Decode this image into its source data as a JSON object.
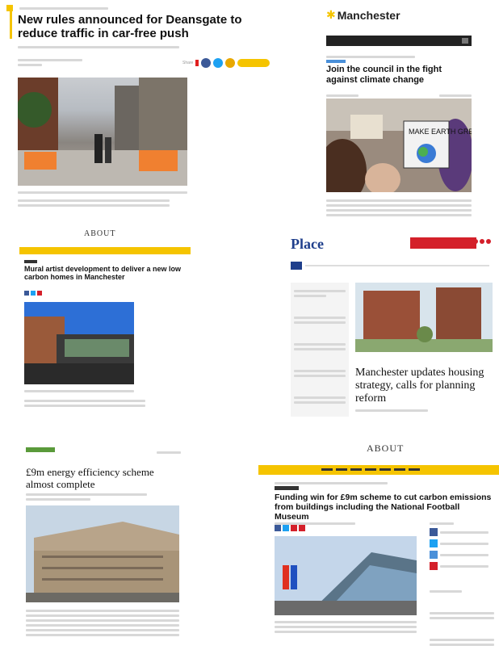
{
  "articles": [
    {
      "title": "New rules announced for Deansgate to reduce traffic in car-free push",
      "social_colors": [
        "#e02020",
        "#3b5998",
        "#1da1f2",
        "#e8a800"
      ]
    },
    {
      "site": "Manchester",
      "title": "Join the council in the fight against climate change",
      "placard": "MAKE EARTH GREEN AGAIN"
    },
    {
      "site": "ABOUT",
      "title": "Mural artist development to deliver a new low carbon homes in Manchester"
    },
    {
      "site": "Place",
      "title": "Manchester updates housing strategy, calls for planning reform"
    },
    {
      "title": "£9m energy efficiency scheme almost complete"
    },
    {
      "site": "ABOUT",
      "title": "Funding win for £9m scheme to cut carbon emissions from buildings including the National Football Museum"
    }
  ],
  "colors": {
    "yellow": "#f5c400",
    "red": "#d4202a",
    "navy": "#1f3f8c",
    "dark": "#222222"
  }
}
